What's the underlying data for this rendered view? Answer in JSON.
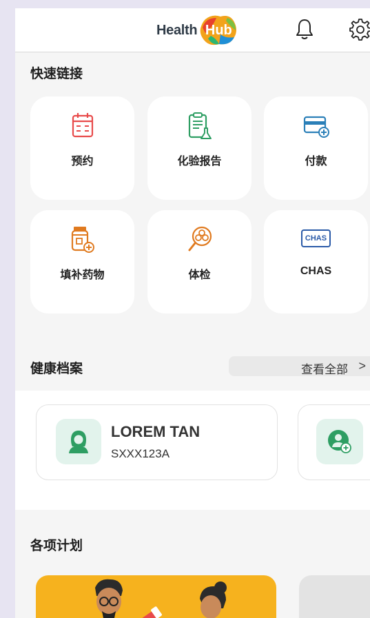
{
  "header": {
    "logo_health": "Health",
    "logo_hub": "Hub",
    "icons": [
      "bell-icon",
      "gear-icon"
    ]
  },
  "quick_links": {
    "title": "快速链接",
    "items": [
      {
        "label": "预约",
        "icon": "calendar-icon"
      },
      {
        "label": "化验报告",
        "icon": "lab-report-icon"
      },
      {
        "label": "付款",
        "icon": "payment-card-icon"
      },
      {
        "label": "填补药物",
        "icon": "medicine-refill-icon"
      },
      {
        "label": "体检",
        "icon": "screening-icon"
      },
      {
        "label": "CHAS",
        "icon": "chas-icon"
      }
    ]
  },
  "chas_badge": "CHAS",
  "health_records": {
    "title": "健康档案",
    "view_all": "查看全部",
    "chevron": ">",
    "profile": {
      "name": "LOREM TAN",
      "id": "SXXX123A"
    }
  },
  "programmes": {
    "title": "各项计划"
  },
  "colors": {
    "accent_red": "#e84a4a",
    "accent_green": "#2e9e63",
    "accent_blue": "#2a7fb8",
    "accent_orange": "#e07a1f",
    "programme_yellow": "#f6b21e"
  }
}
